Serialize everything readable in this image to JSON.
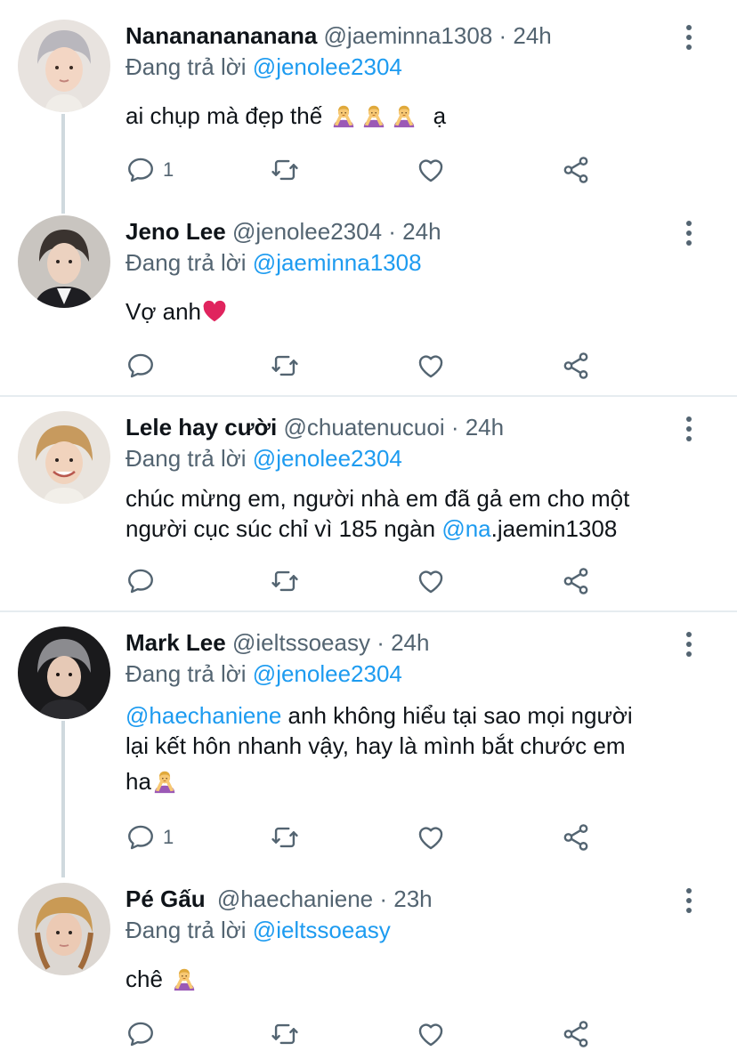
{
  "colors": {
    "accent": "#1d9bf0",
    "secondary": "#536471",
    "text": "#0f1419",
    "divider": "#e6ecf0"
  },
  "tweets": [
    {
      "name": "Nanananananana",
      "meta": "@jaeminna1308 · 24h",
      "replying_prefix": "Đang trả lời",
      "replying_to": "@jenolee2304",
      "text": "ai chụp mà đẹp thế",
      "text_suffix": "ạ",
      "reply_count": "1"
    },
    {
      "name": "Jeno Lee",
      "meta": "@jenolee2304 · 24h",
      "replying_prefix": "Đang trả lời",
      "replying_to": "@jaeminna1308",
      "text": "Vợ anh",
      "reply_count": ""
    },
    {
      "name": "Lele hay cười",
      "meta": "@chuatenucuoi · 24h",
      "replying_prefix": "Đang trả lời",
      "replying_to": "@jenolee2304",
      "text_line1": "chúc mừng em, người nhà em đã gả em cho một",
      "text_line2": "người cục súc chỉ vì 185 ngàn ",
      "text_mention": "@na",
      "text_tail": ".jaemin1308",
      "reply_count": ""
    },
    {
      "name": "Mark Lee",
      "meta": "@ieltssoeasy · 24h",
      "replying_prefix": "Đang trả lời",
      "replying_to": "@jenolee2304",
      "text_mention": "@haechaniene",
      "text_line1": " anh không hiểu tại sao mọi người",
      "text_line2": "lại kết hôn nhanh vậy, hay là mình bắt chước em",
      "text_line3": "ha",
      "reply_count": "1"
    },
    {
      "name": "Pé Gấu",
      "meta": "@haechaniene · 23h",
      "replying_prefix": "Đang trả lời",
      "replying_to": "@ieltssoeasy",
      "text": "chê",
      "reply_count": ""
    }
  ],
  "icons": [
    "reply-icon",
    "retweet-icon",
    "like-icon",
    "share-icon",
    "more-icon",
    "person-gesturing-no-emoji",
    "red-heart-emoji"
  ]
}
